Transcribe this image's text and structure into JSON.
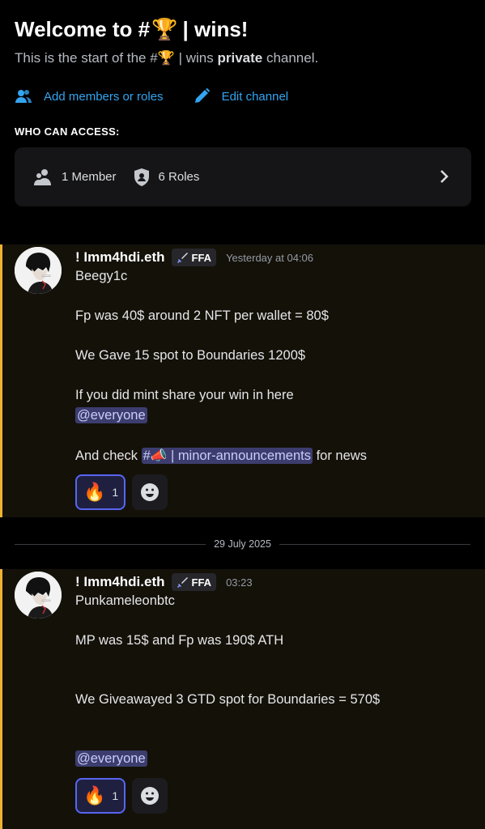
{
  "header": {
    "title_prefix": "Welcome to #",
    "title_emoji": "🏆",
    "title_suffix": "| wins!",
    "subtitle_prefix": "This is the start of the #",
    "subtitle_emoji": "🏆",
    "subtitle_mid": " | wins ",
    "subtitle_bold": "private",
    "subtitle_end": " channel."
  },
  "actions": {
    "add_members": "Add members or roles",
    "edit_channel": "Edit channel"
  },
  "access": {
    "label": "WHO CAN ACCESS:",
    "members": "1 Member",
    "roles": "6 Roles"
  },
  "messages": [
    {
      "username": "! Imm4hdi.eth",
      "tag": "FFA",
      "timestamp": "Yesterday at 04:06",
      "line1": "Beegy1c",
      "line2": "Fp was 40$ around 2 NFT per wallet = 80$",
      "line3": "We Gave 15 spot to Boundaries 1200$",
      "line4": "If you did mint share your win in here",
      "mention": "@everyone",
      "line5_prefix": "And check ",
      "channel_mention": "#📣 | minor-announcements",
      "line5_suffix": " for news",
      "reaction_emoji": "🔥",
      "reaction_count": "1"
    },
    {
      "username": "! Imm4hdi.eth",
      "tag": "FFA",
      "timestamp": "03:23",
      "line1": "Punkameleonbtc",
      "line2": "MP was 15$ and Fp was 190$ ATH",
      "line3": "We Giveawayed 3 GTD spot for Boundaries = 570$",
      "mention": "@everyone",
      "reaction_emoji": "🔥",
      "reaction_count": "1"
    }
  ],
  "date_divider": "29 July 2025",
  "colors": {
    "accent_link": "#33a4f0",
    "mention_bg": "#3c3d6e",
    "highlight_border": "#f0b232",
    "reaction_border": "#5865f2"
  }
}
